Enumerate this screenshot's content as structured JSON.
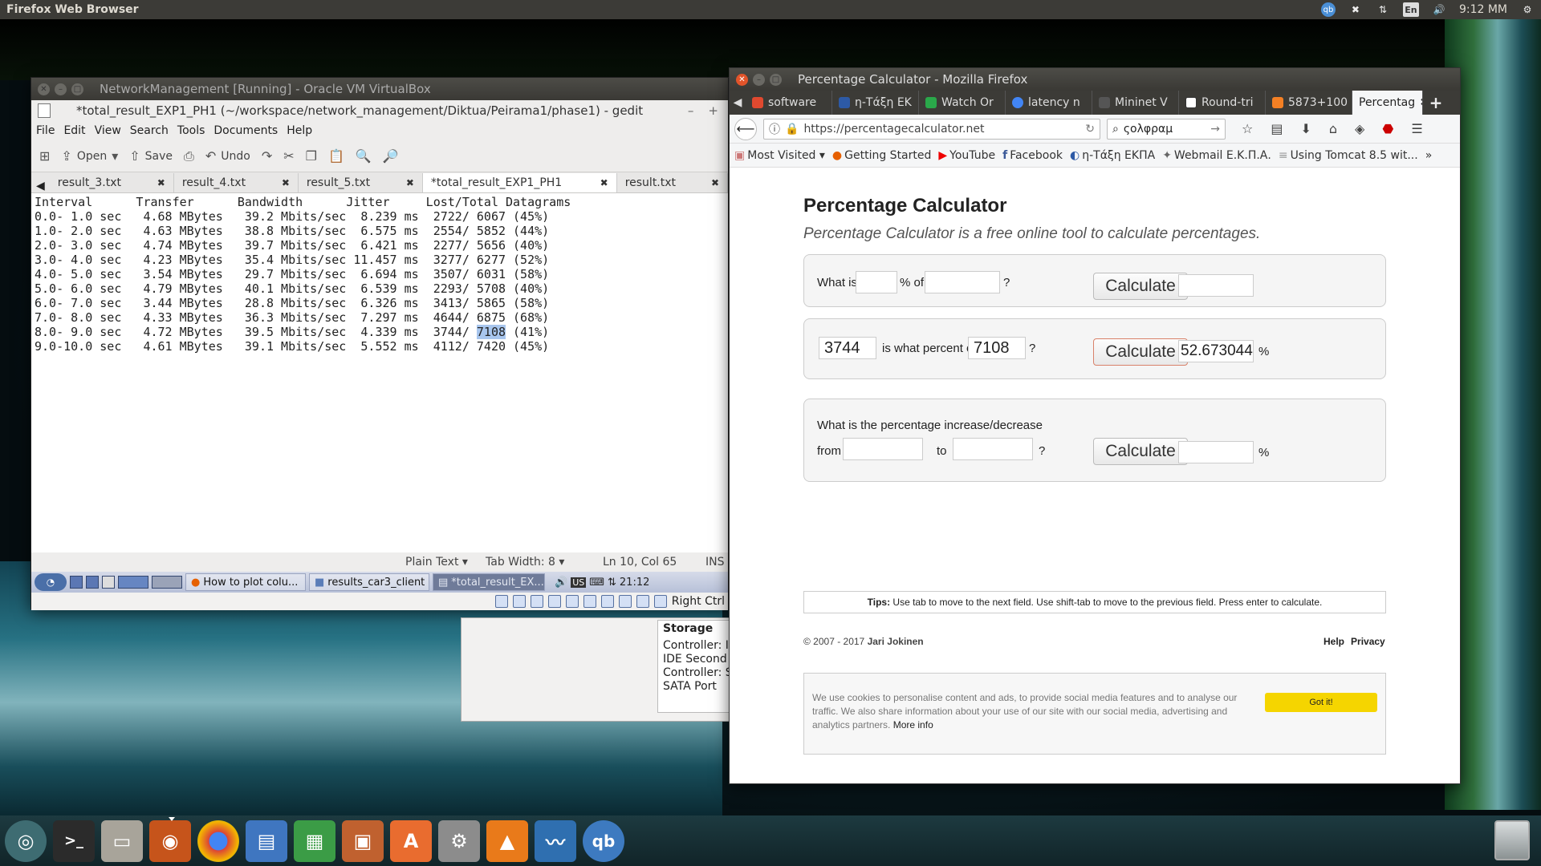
{
  "top_panel": {
    "app_title": "Firefox Web Browser",
    "lang": "En",
    "clock": "9:12 ΜΜ"
  },
  "vbox": {
    "title": "NetworkManagement [Running] - Oracle VM VirtualBox",
    "gedit": {
      "title": "*total_result_EXP1_PH1 (~/workspace/network_management/Diktua/Peirama1/phase1) - gedit",
      "menu": [
        "File",
        "Edit",
        "View",
        "Search",
        "Tools",
        "Documents",
        "Help"
      ],
      "toolbar": {
        "open": "Open",
        "save": "Save",
        "undo": "Undo"
      },
      "tabs": [
        "result_3.txt",
        "result_4.txt",
        "result_5.txt",
        "*total_result_EXP1_PH1",
        "result.txt"
      ],
      "lines": [
        "Interval      Transfer      Bandwidth      Jitter     Lost/Total Datagrams",
        "0.0- 1.0 sec   4.68 MBytes   39.2 Mbits/sec  8.239 ms  2722/ 6067 (45%)",
        "1.0- 2.0 sec   4.63 MBytes   38.8 Mbits/sec  6.575 ms  2554/ 5852 (44%)",
        "2.0- 3.0 sec   4.74 MBytes   39.7 Mbits/sec  6.421 ms  2277/ 5656 (40%)",
        "3.0- 4.0 sec   4.23 MBytes   35.4 Mbits/sec 11.457 ms  3277/ 6277 (52%)",
        "4.0- 5.0 sec   3.54 MBytes   29.7 Mbits/sec  6.694 ms  3507/ 6031 (58%)",
        "5.0- 6.0 sec   4.79 MBytes   40.1 Mbits/sec  6.539 ms  2293/ 5708 (40%)",
        "6.0- 7.0 sec   3.44 MBytes   28.8 Mbits/sec  6.326 ms  3413/ 5865 (58%)",
        "7.0- 8.0 sec   4.33 MBytes   36.3 Mbits/sec  7.297 ms  4644/ 6875 (68%)",
        "9.0-10.0 sec   4.61 MBytes   39.1 Mbits/sec  5.552 ms  4112/ 7420 (45%)"
      ],
      "hl_line": {
        "pre": "8.0- 9.0 sec   4.72 MBytes   39.5 Mbits/sec  4.339 ms  3744/ ",
        "sel": "7108",
        "post": " (41%)"
      },
      "status": {
        "lang": "Plain Text ▾",
        "tab": "Tab Width: 8 ▾",
        "pos": "Ln 10, Col 65",
        "mode": "INS"
      }
    },
    "taskbar": [
      "How to plot colu...",
      "results_car3_client",
      "*total_result_EX..."
    ],
    "tray_time": "21:12",
    "tray_kb": "US",
    "host_key": "Right Ctrl"
  },
  "storage": {
    "title": "Storage",
    "lines": [
      "Controller: I",
      " IDE Second",
      "Controller: S",
      " SATA Port"
    ]
  },
  "firefox": {
    "title": "Percentage Calculator - Mozilla Firefox",
    "tabs": [
      {
        "label": "software",
        "color": "#e0492f"
      },
      {
        "label": "η-Τάξη ΕΚ",
        "color": "#2d5aa6"
      },
      {
        "label": "Watch Or",
        "color": "#2aa84a"
      },
      {
        "label": "latency n",
        "color": "#4285f4"
      },
      {
        "label": "Mininet V",
        "color": "#555555"
      },
      {
        "label": "Round-tri",
        "color": "#333333"
      },
      {
        "label": "5873+100",
        "color": "#f48024"
      }
    ],
    "active_tab": "Percentag",
    "url": "https://percentagecalculator.net",
    "search": "ςολφραμ",
    "bookmarks": [
      "Most Visited ▾",
      "Getting Started",
      "YouTube",
      "Facebook",
      "η-Τάξη ΕΚΠΑ",
      "Webmail Ε.Κ.Π.Α.",
      "Using Tomcat 8.5 wit..."
    ]
  },
  "page": {
    "title": "Percentage Calculator",
    "subtitle": "Percentage Calculator is a free online tool to calculate percentages.",
    "p1": {
      "what_is": "What is",
      "pct_of": "% of",
      "q": "?"
    },
    "p2": {
      "a": "3744",
      "mid": "is what percent of",
      "b": "7108",
      "q": "?",
      "result": "52.6730444",
      "pct": "%"
    },
    "p3": {
      "line1": "What is the percentage increase/decrease",
      "from": "from",
      "to": "to",
      "q": "?",
      "pct": "%"
    },
    "calculate": "Calculate",
    "tips_b": "Tips:",
    "tips": " Use tab to move to the next field. Use shift-tab to move to the previous field. Press enter to calculate.",
    "copyright_pre": "© 2007 - 2017 ",
    "copyright_name": "Jari Jokinen",
    "help": "Help",
    "privacy": "Privacy",
    "cookie_text": "We use cookies to personalise content and ads, to provide social media features and to analyse our traffic. We also share information about your use of our site with our social media, advertising and analytics partners. ",
    "more_info": "More info",
    "got_it": "Got it!"
  }
}
